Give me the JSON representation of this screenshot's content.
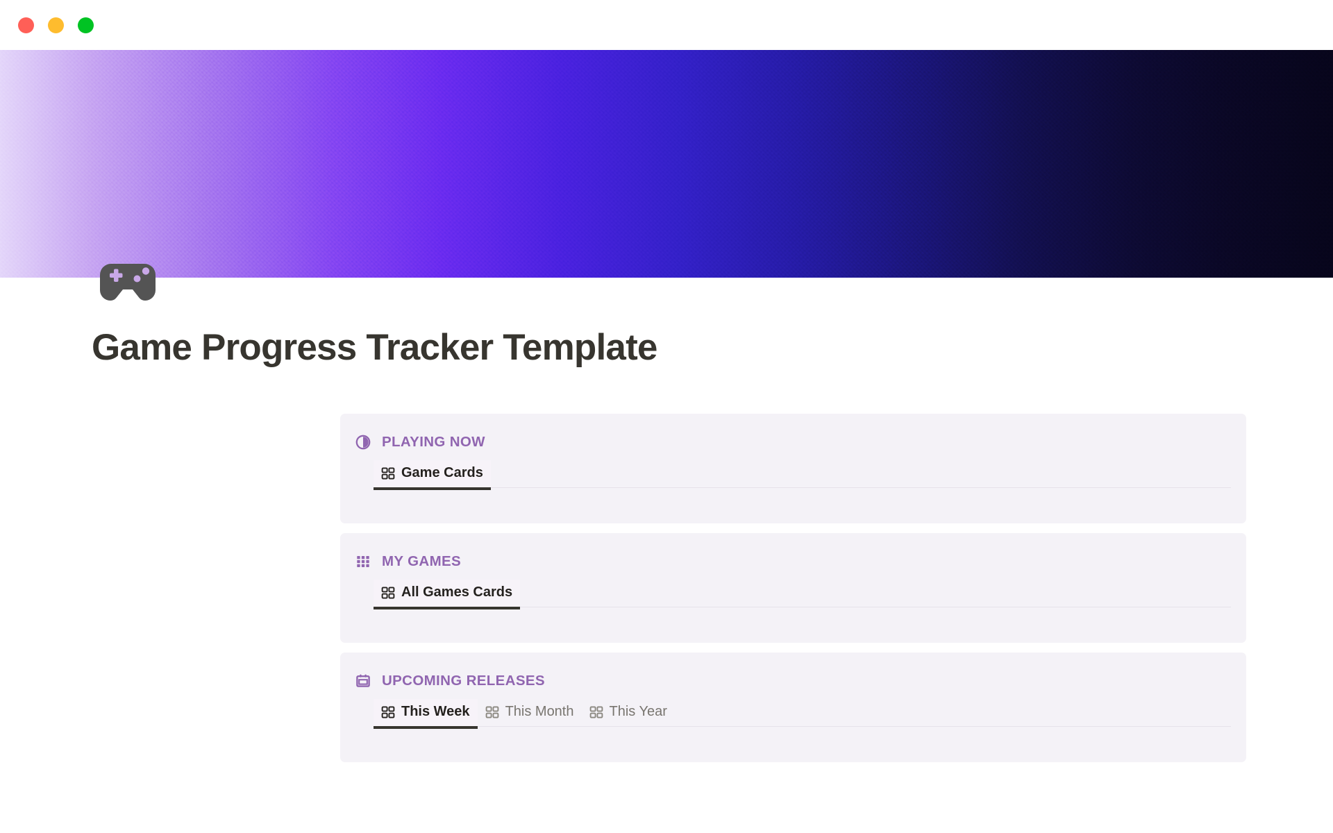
{
  "window": {
    "traffic_lights": [
      {
        "name": "close",
        "color": "#ff5f57"
      },
      {
        "name": "minimize",
        "color": "#febc2e"
      },
      {
        "name": "maximize",
        "color": "#00c323"
      }
    ]
  },
  "cover": {
    "icon": "game-controller-icon",
    "gradient_from": "#e4d6fa",
    "gradient_mid": "#3320c8",
    "gradient_to": "#07051b"
  },
  "page": {
    "title": "Game Progress Tracker Template",
    "title_color": "#37352f"
  },
  "theme": {
    "section_heading_color": "#9065b0",
    "card_background": "#f4f2f7",
    "active_tab_color": "#24211e",
    "inactive_tab_color": "#78756f",
    "active_underline_color": "#37352f"
  },
  "sections": [
    {
      "id": "playing-now",
      "title": "PLAYING NOW",
      "icon": "pie-progress-icon",
      "tabs": [
        {
          "label": "Game Cards",
          "icon": "gallery-view-icon",
          "active": true
        }
      ]
    },
    {
      "id": "my-games",
      "title": "MY GAMES",
      "icon": "grid-dots-icon",
      "tabs": [
        {
          "label": "All Games Cards",
          "icon": "gallery-view-icon",
          "active": true
        }
      ]
    },
    {
      "id": "upcoming-releases",
      "title": "UPCOMING RELEASES",
      "icon": "calendar-icon",
      "tabs": [
        {
          "label": "This Week",
          "icon": "gallery-view-icon",
          "active": true
        },
        {
          "label": "This Month",
          "icon": "gallery-view-icon",
          "active": false
        },
        {
          "label": "This Year",
          "icon": "gallery-view-icon",
          "active": false
        }
      ]
    }
  ]
}
